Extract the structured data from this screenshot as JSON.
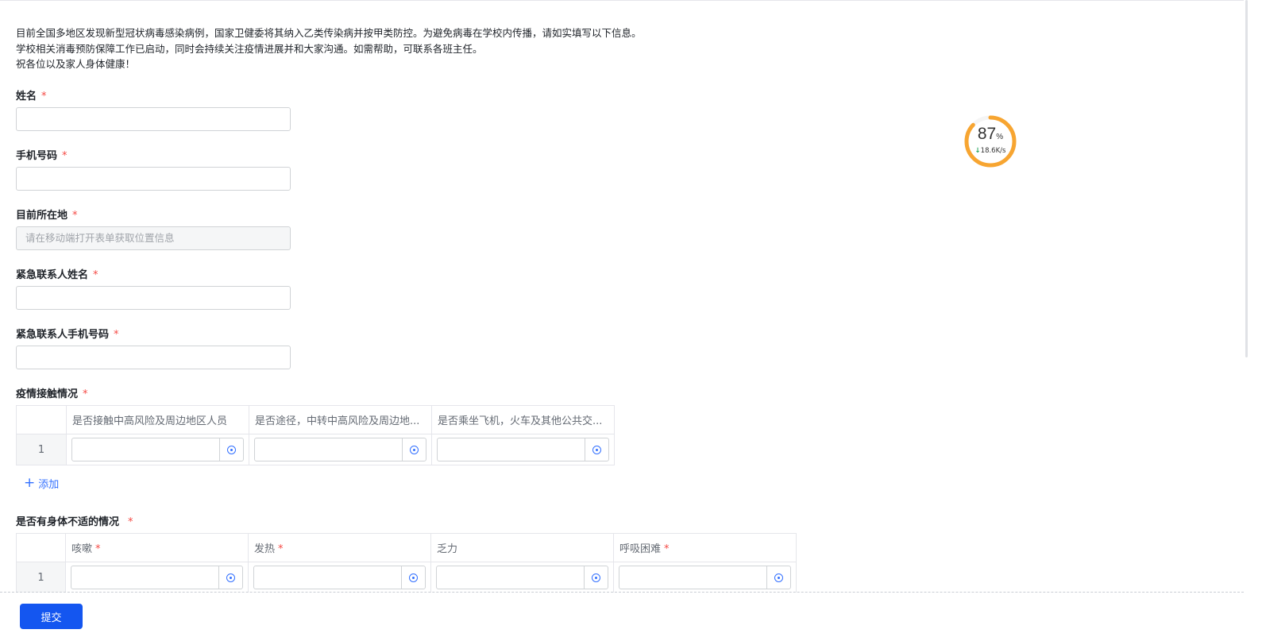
{
  "intro": {
    "lines": [
      "目前全国多地区发现新型冠状病毒感染病例，国家卫健委将其纳入乙类传染病并按甲类防控。为避免病毒在学校内传播，请如实填写以下信息。",
      "学校相关消毒预防保障工作已启动，同时会持续关注疫情进展并和大家沟通。如需帮助，可联系各班主任。",
      "祝各位以及家人身体健康！"
    ]
  },
  "fields": {
    "name": {
      "label": "姓名",
      "required": "*"
    },
    "phone": {
      "label": "手机号码",
      "required": "*"
    },
    "location": {
      "label": "目前所在地",
      "required": "*",
      "placeholder": "请在移动端打开表单获取位置信息"
    },
    "emergency_name": {
      "label": "紧急联系人姓名",
      "required": "*"
    },
    "emergency_phone": {
      "label": "紧急联系人手机号码",
      "required": "*"
    }
  },
  "contact_table": {
    "label": "疫情接触情况",
    "required": "*",
    "columns": [
      "是否接触中高风险及周边地区人员",
      "是否途径，中转中高风险及周边地...",
      "是否乘坐飞机，火车及其他公共交..."
    ],
    "rows": [
      {
        "index": "1"
      }
    ],
    "add_label": "添加"
  },
  "symptom_table": {
    "label": "是否有身体不适的情况",
    "required": "*",
    "columns": [
      {
        "name": "咳嗽",
        "required": "*"
      },
      {
        "name": "发热",
        "required": "*"
      },
      {
        "name": "乏力",
        "required": ""
      },
      {
        "name": "呼吸困难",
        "required": "*"
      }
    ],
    "rows": [
      {
        "index": "1"
      }
    ]
  },
  "footer": {
    "submit_label": "提交"
  },
  "net_widget": {
    "percent": "87",
    "percent_unit": "%",
    "speed": "18.6K/s",
    "value": 87
  }
}
